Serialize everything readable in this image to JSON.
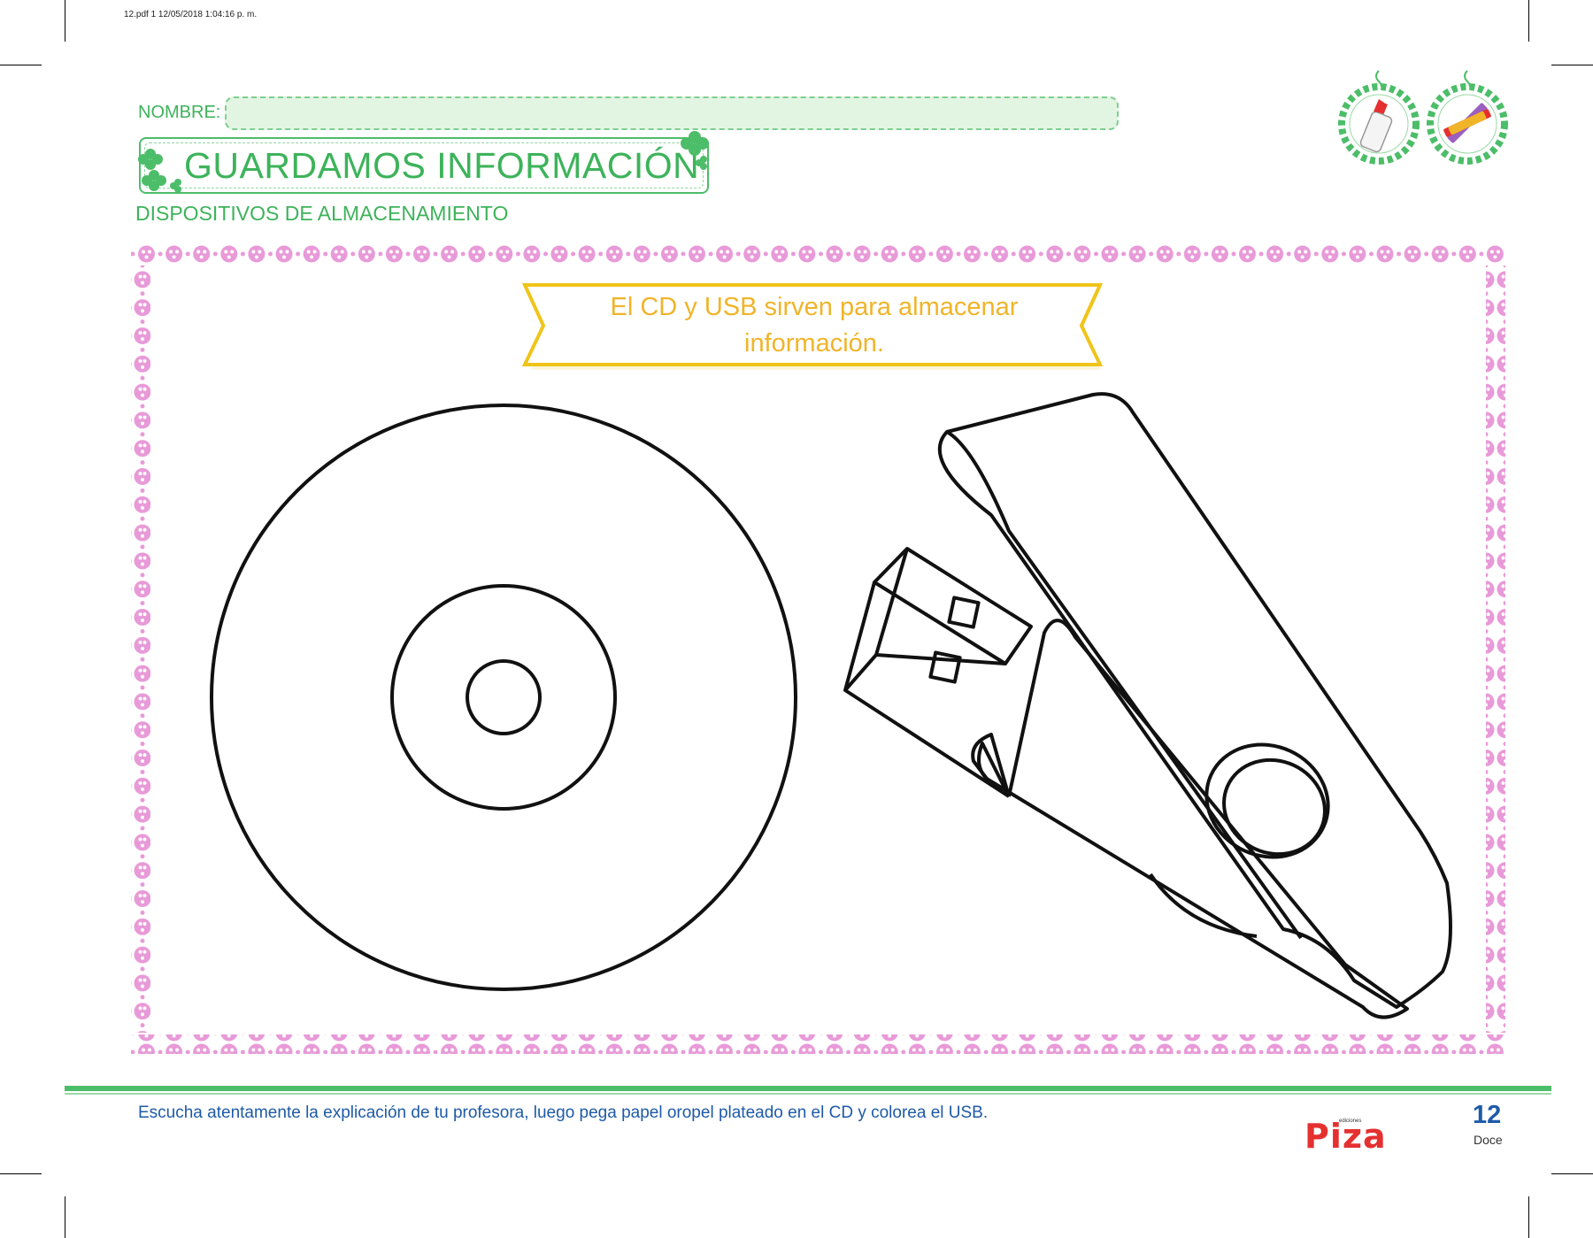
{
  "print_info": "12.pdf   1   12/05/2018   1:04:16 p. m.",
  "nombre_label": "NOMBRE:",
  "title": "GUARDAMOS INFORMACIÓN",
  "subtitle": "DISPOSITIVOS DE ALMACENAMIENTO",
  "banner": {
    "line1": "El CD y USB sirven para almacenar",
    "line2": "información."
  },
  "instruction": "Escucha atentamente la explicación de tu profesora, luego pega papel oropel plateado en el CD y colorea el USB.",
  "logo": {
    "small": "ediciones",
    "main": "Piza"
  },
  "page": {
    "number": "12",
    "word": "Doce"
  },
  "icons": [
    "glue-bottle-icon",
    "crayons-icon",
    "cd-illustration",
    "usb-illustration"
  ],
  "colors": {
    "green": "#3db35a",
    "pink_border": "#e89ad8",
    "banner_yellow": "#f0b429",
    "blue": "#1e5aa8",
    "logo_red": "#e53030"
  }
}
